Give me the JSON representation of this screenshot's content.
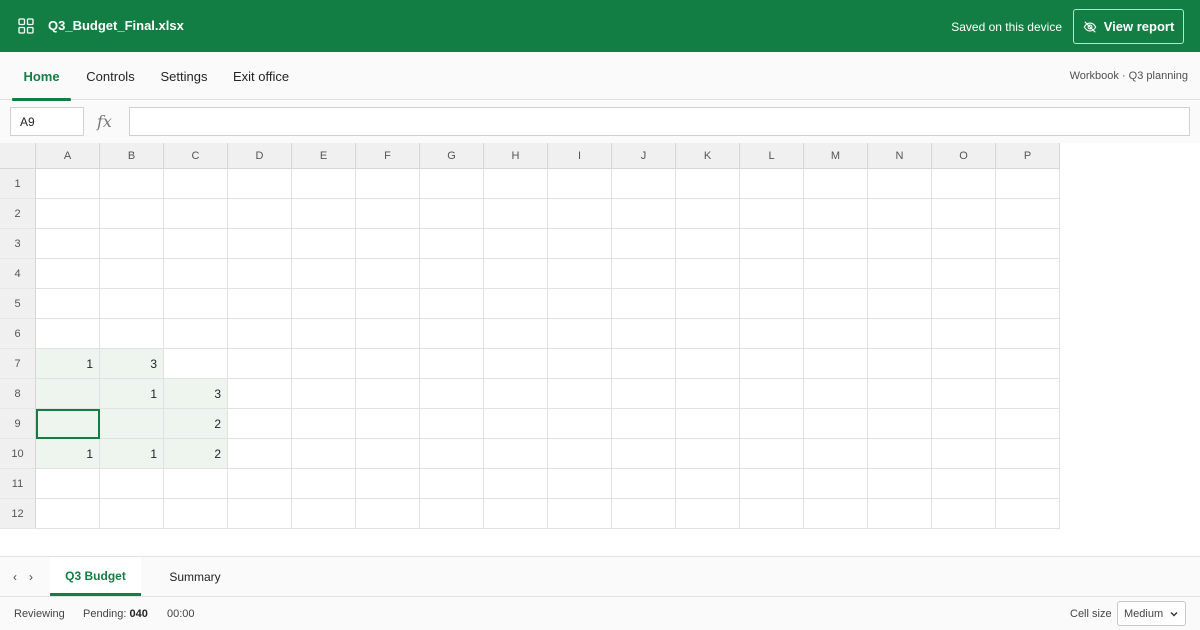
{
  "titlebar": {
    "file_name": "Q3_Budget_Final.xlsx",
    "saved_status": "Saved on this device",
    "view_report_label": "View report",
    "background": "#137e43"
  },
  "ribbon": {
    "tabs": [
      "Home",
      "Controls",
      "Settings",
      "Exit office"
    ],
    "active_tab": "Home",
    "workbook_label": "Workbook · Q3 planning"
  },
  "formula_bar": {
    "name_box": "A9",
    "fx_label": "fx",
    "formula": ""
  },
  "grid": {
    "columns": [
      "A",
      "B",
      "C",
      "D",
      "E",
      "F",
      "G",
      "H",
      "I",
      "J",
      "K",
      "L",
      "M",
      "N",
      "O",
      "P"
    ],
    "rows": [
      "1",
      "2",
      "3",
      "4",
      "5",
      "6",
      "7",
      "8",
      "9",
      "10",
      "11",
      "12"
    ],
    "selected_cell": "A9",
    "cells": [
      {
        "ref": "A7",
        "value": "1"
      },
      {
        "ref": "B7",
        "value": "3"
      },
      {
        "ref": "B8",
        "value": "1"
      },
      {
        "ref": "C8",
        "value": "3"
      },
      {
        "ref": "C9",
        "value": "2"
      },
      {
        "ref": "A10",
        "value": "1"
      },
      {
        "ref": "B10",
        "value": "1"
      },
      {
        "ref": "C10",
        "value": "2"
      }
    ],
    "shaded_cells": [
      "A7",
      "B7",
      "A8",
      "B8",
      "C8",
      "A9",
      "B9",
      "C9",
      "A10",
      "B10",
      "C10"
    ]
  },
  "sheets": {
    "prev_arrow": "‹",
    "next_arrow": "›",
    "tabs": [
      "Q3 Budget",
      "Summary"
    ],
    "active": "Q3 Budget"
  },
  "status_bar": {
    "mode": "Reviewing",
    "pending_label": "Pending:",
    "pending_value": "040",
    "timer": "00:00",
    "cell_size_label": "Cell size",
    "cell_size_value": "Medium"
  }
}
